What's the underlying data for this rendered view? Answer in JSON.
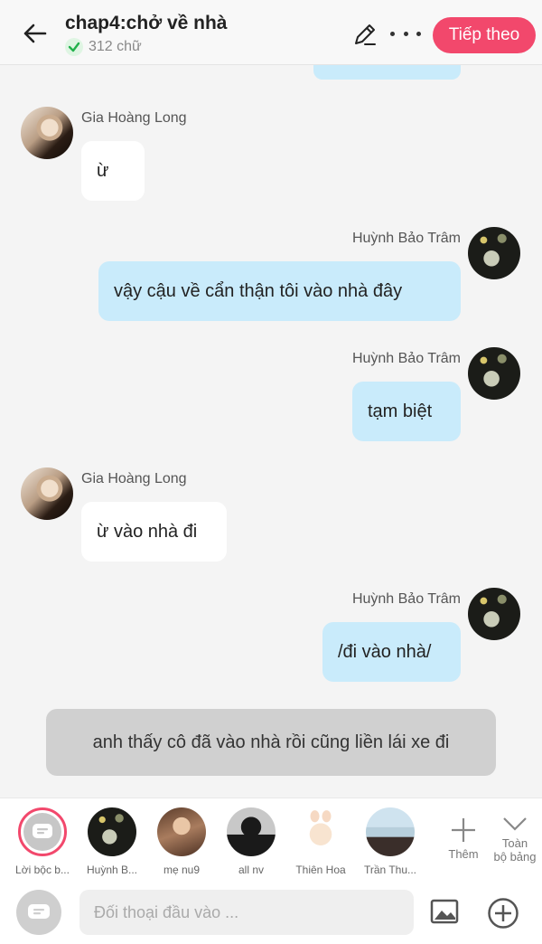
{
  "header": {
    "title": "chap4:chở về nhà",
    "word_count": "312 chữ",
    "next_label": "Tiếp theo",
    "accent": "#f2486c"
  },
  "messages": [
    {
      "sender": "Gia Hoàng Long",
      "side": "left",
      "text": "ừ"
    },
    {
      "sender": "Huỳnh Bảo Trâm",
      "side": "right",
      "text": "vậy cậu về cẩn thận tôi vào nhà đây"
    },
    {
      "sender": "Huỳnh Bảo Trâm",
      "side": "right",
      "text": "tạm biệt"
    },
    {
      "sender": "Gia Hoàng Long",
      "side": "left",
      "text": "ừ vào nhà đi"
    },
    {
      "sender": "Huỳnh Bảo Trâm",
      "side": "right",
      "text": "/đi vào nhà/"
    }
  ],
  "narration": "anh thấy cô đã vào nhà rồi cũng liền lái xe đi",
  "characters": [
    {
      "label": "Lời bộc b...",
      "icon": "chat-icon",
      "selected": true
    },
    {
      "label": "Huỳnh B..."
    },
    {
      "label": "mẹ nu9"
    },
    {
      "label": "all nv"
    },
    {
      "label": "Thiên Hoa"
    },
    {
      "label": "Trần Thu..."
    }
  ],
  "add_more_label": "Thêm",
  "collapse_label_1": "Toàn",
  "collapse_label_2": "bộ bảng",
  "input": {
    "placeholder": "Đối thoại đầu vào ..."
  },
  "colors": {
    "bubble_right": "#c9ebfb",
    "bubble_left": "#ffffff",
    "narration": "#d0d0d0"
  }
}
